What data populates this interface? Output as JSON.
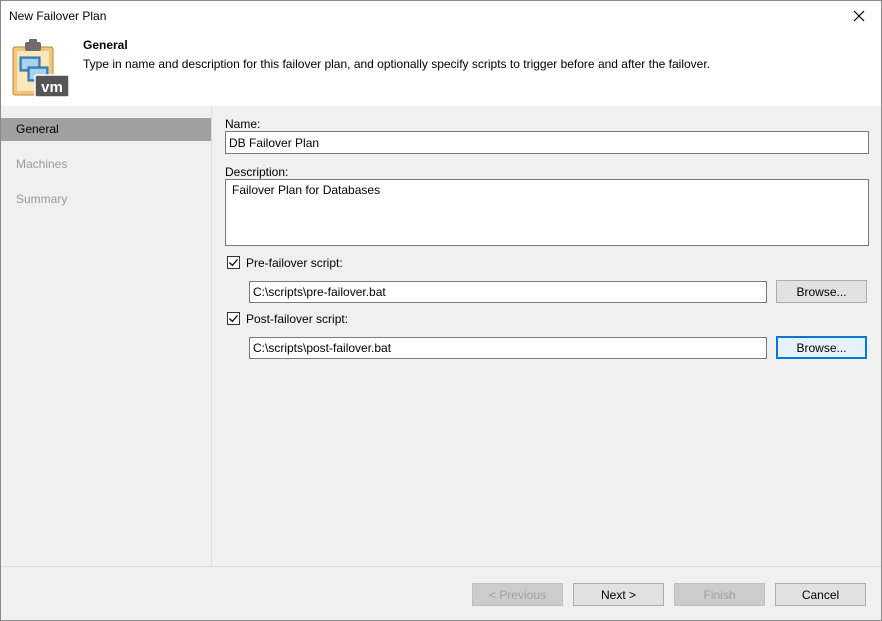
{
  "window": {
    "title": "New Failover Plan"
  },
  "header": {
    "title": "General",
    "description": "Type in name and description for this failover plan, and optionally specify scripts to trigger before and after the failover."
  },
  "sidebar": {
    "steps": [
      {
        "label": "General",
        "active": true
      },
      {
        "label": "Machines",
        "active": false
      },
      {
        "label": "Summary",
        "active": false
      }
    ]
  },
  "form": {
    "name_label": "Name:",
    "name_value": "DB Failover Plan",
    "description_label": "Description:",
    "description_value": "Failover Plan for Databases",
    "pre_script_label": "Pre-failover script:",
    "pre_script_checked": true,
    "pre_script_path": "C:\\scripts\\pre-failover.bat",
    "pre_browse_label": "Browse...",
    "post_script_label": "Post-failover script:",
    "post_script_checked": true,
    "post_script_path": "C:\\scripts\\post-failover.bat",
    "post_browse_label": "Browse..."
  },
  "footer": {
    "previous_label": "< Previous",
    "next_label": "Next >",
    "finish_label": "Finish",
    "cancel_label": "Cancel"
  },
  "icons": {
    "close": "close-icon",
    "header": "failover-plan-vm-icon",
    "checkmark": "checkmark-icon"
  },
  "colors": {
    "active_step_bg": "#a0a0a0",
    "inactive_step_text": "#9a9a9a",
    "focus_border": "#0078d7"
  }
}
